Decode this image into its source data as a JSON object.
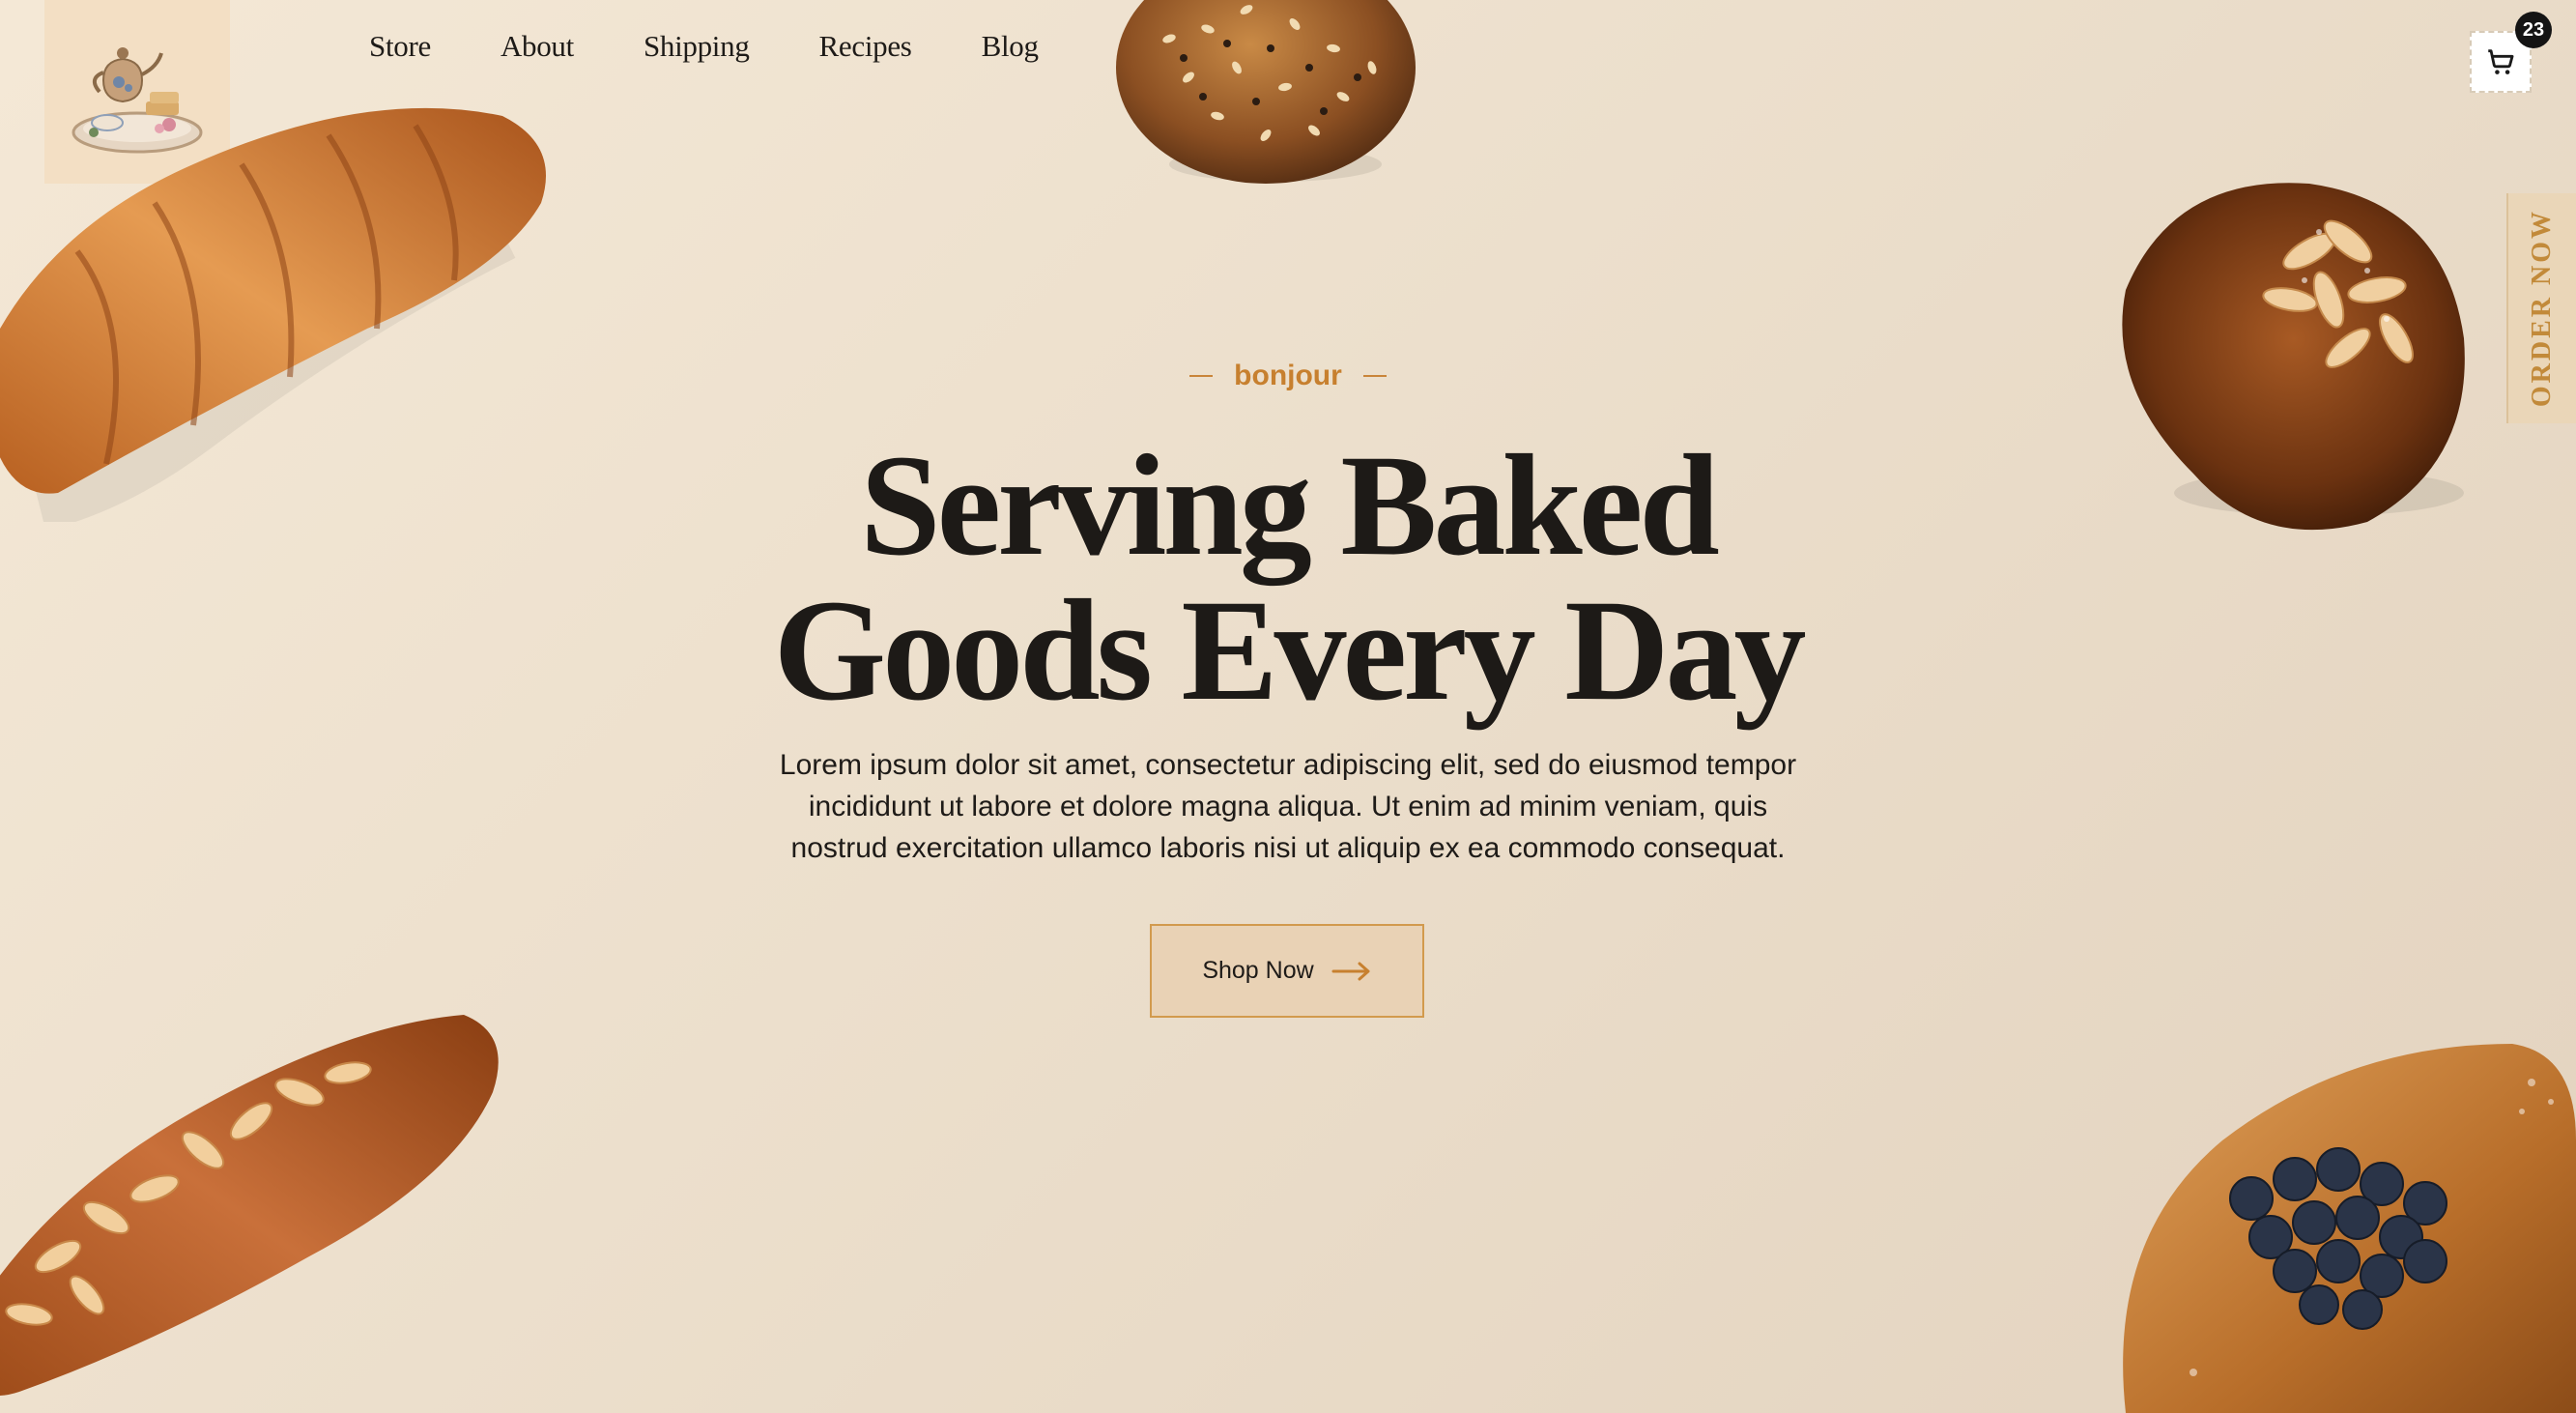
{
  "nav": {
    "items": [
      {
        "label": "Store"
      },
      {
        "label": "About"
      },
      {
        "label": "Shipping"
      },
      {
        "label": "Recipes"
      },
      {
        "label": "Blog"
      }
    ]
  },
  "cart": {
    "count": "23",
    "icon": "cart-icon"
  },
  "side_tab": {
    "label": "ORDER NOW"
  },
  "hero": {
    "eyebrow": "bonjour",
    "headline_line1": "Serving Baked",
    "headline_line2_regular": "Goods ",
    "headline_line2_bold": "Every Day",
    "body": "Lorem ipsum dolor sit amet, consectetur adipiscing elit, sed do eiusmod tempor incididunt ut labore et dolore magna aliqua. Ut enim ad minim veniam, quis nostrud exercitation ullamco laboris nisi ut aliquip ex ea commodo consequat.",
    "cta_label": "Shop Now"
  },
  "colors": {
    "accent": "#c7802f",
    "text": "#1e1b18",
    "background": "#ecdfcc",
    "button_bg": "#e9d2b5"
  }
}
